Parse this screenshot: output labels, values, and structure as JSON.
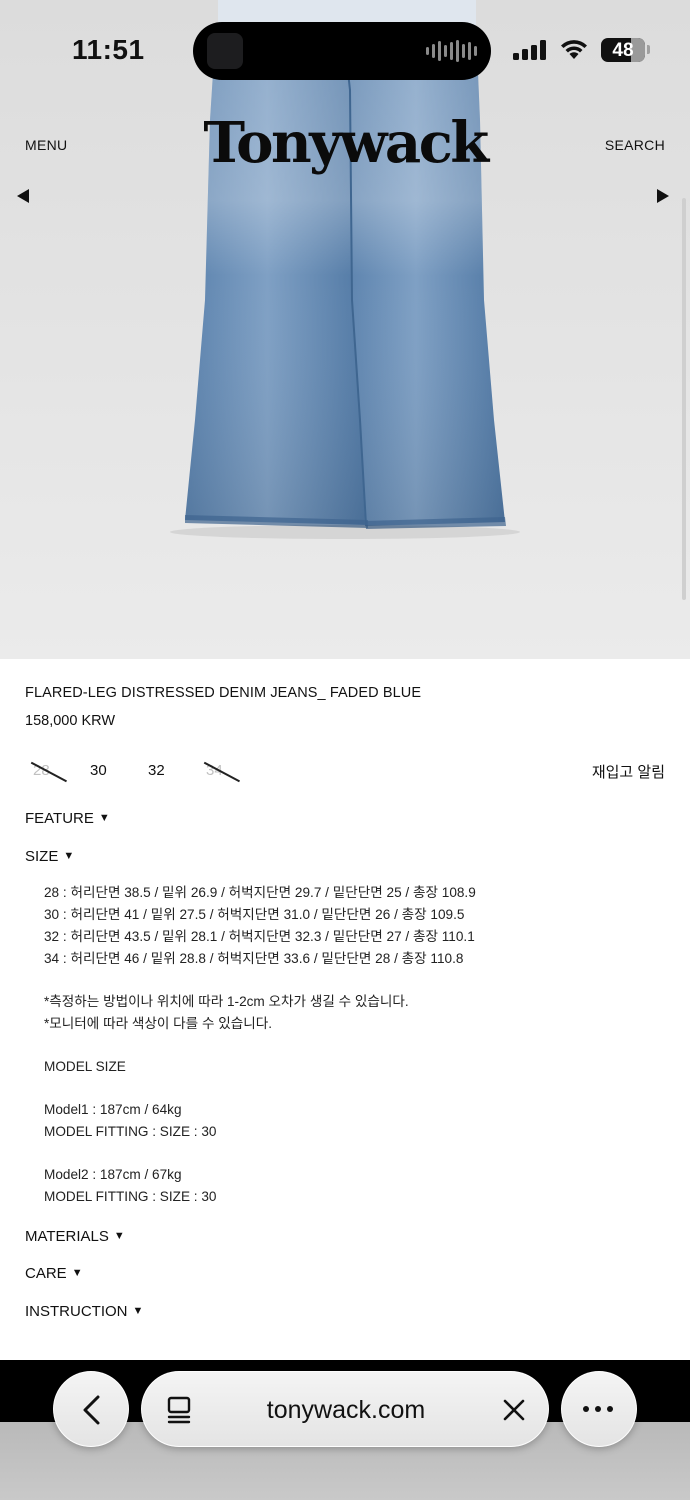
{
  "status_bar": {
    "time": "11:51",
    "battery": "48"
  },
  "header": {
    "menu": "MENU",
    "logo": "Tonywack",
    "search": "SEARCH"
  },
  "product": {
    "title": "FLARED-LEG DISTRESSED DENIM JEANS_ FADED BLUE",
    "price": "158,000 KRW",
    "sizes": [
      {
        "label": "28",
        "sold_out": true
      },
      {
        "label": "30",
        "sold_out": false
      },
      {
        "label": "32",
        "sold_out": false
      },
      {
        "label": "34",
        "sold_out": true
      }
    ],
    "restock": "재입고 알림"
  },
  "sections": {
    "feature": "FEATURE",
    "size": "SIZE",
    "materials": "MATERIALS",
    "care": "CARE",
    "instruction": "INSTRUCTION",
    "toggle": "▼"
  },
  "size_info": {
    "rows": [
      "28 : 허리단면 38.5 / 밑위 26.9 / 허벅지단면 29.7 / 밑단단면 25 / 총장 108.9",
      "30 : 허리단면 41 / 밑위 27.5 / 허벅지단면 31.0 / 밑단단면 26 / 총장 109.5",
      "32 : 허리단면 43.5 / 밑위 28.1 / 허벅지단면 32.3 / 밑단단면 27 / 총장 110.1",
      "34 : 허리단면 46 / 밑위 28.8 / 허벅지단면 33.6 / 밑단단면 28 / 총장 110.8"
    ],
    "notes": [
      "*측정하는 방법이나 위치에 따라 1-2cm 오차가 생길 수 있습니다.",
      "*모니터에 따라 색상이 다를 수 있습니다."
    ],
    "model_heading": "MODEL SIZE",
    "model1": "Model1 : 187cm / 64kg",
    "model1_fit": "MODEL FITTING : SIZE : 30",
    "model2": "Model2 : 187cm / 67kg",
    "model2_fit": "MODEL FITTING : SIZE : 30"
  },
  "browser": {
    "url": "tonywack.com"
  },
  "icons": {
    "prev": "prev-arrow-icon",
    "next": "next-arrow-icon",
    "back": "chevron-left-icon",
    "tabs": "tab-overview-icon",
    "close": "close-icon",
    "more": "more-icon"
  }
}
